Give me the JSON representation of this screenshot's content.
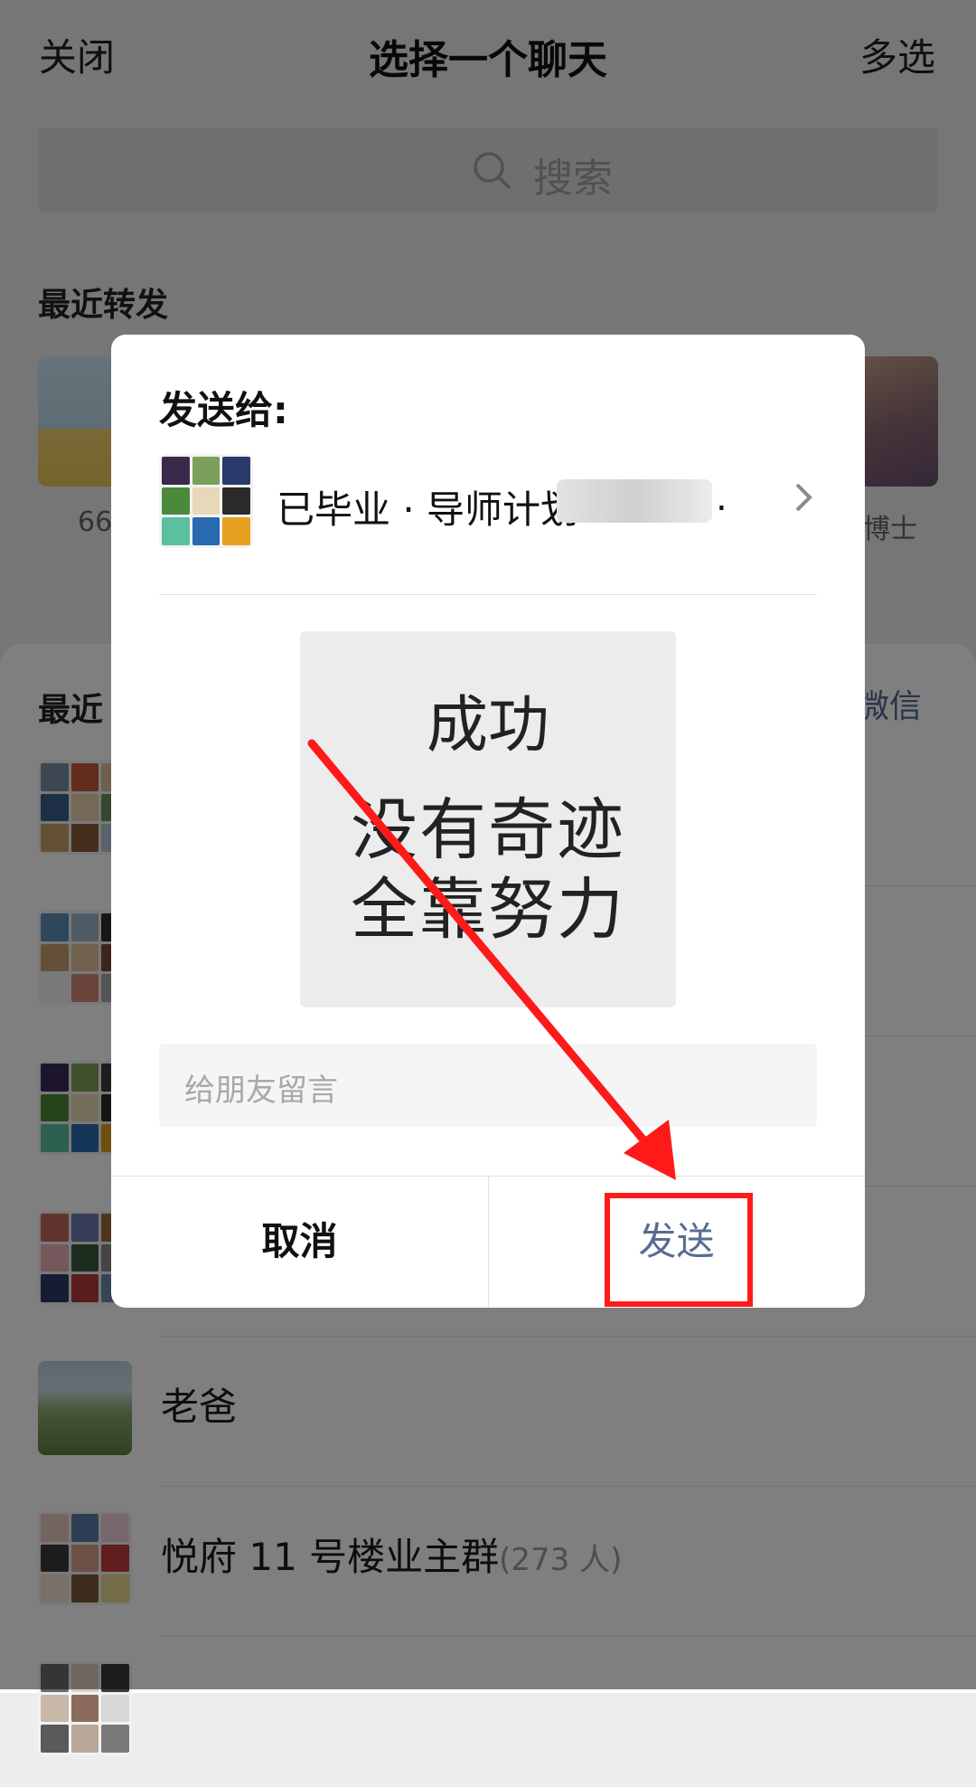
{
  "topbar": {
    "close": "关闭",
    "title": "选择一个聊天",
    "multi_select": "多选"
  },
  "search": {
    "placeholder": "搜索"
  },
  "recent_forward": {
    "heading": "最近转发",
    "items": [
      {
        "label": "66"
      },
      {
        "label": "博士"
      }
    ]
  },
  "recent_chats": {
    "heading": "最近",
    "new_chat_link": "微信",
    "rows": [
      {
        "name": "老爸",
        "count": ""
      },
      {
        "name": "悦府 11 号楼业主群",
        "count": "(273 人)"
      }
    ]
  },
  "dialog": {
    "send_to_label": "发送给:",
    "target_name": "已毕业 · 导师计划",
    "target_suffix": ".",
    "preview_lines": [
      "成功",
      "没有奇迹",
      "全靠努力"
    ],
    "message_placeholder": "给朋友留言",
    "cancel_label": "取消",
    "send_label": "发送"
  },
  "colors": {
    "link": "#576b95",
    "annotation": "#ff1a1a",
    "overlay": "rgba(0,0,0,0.5)"
  }
}
